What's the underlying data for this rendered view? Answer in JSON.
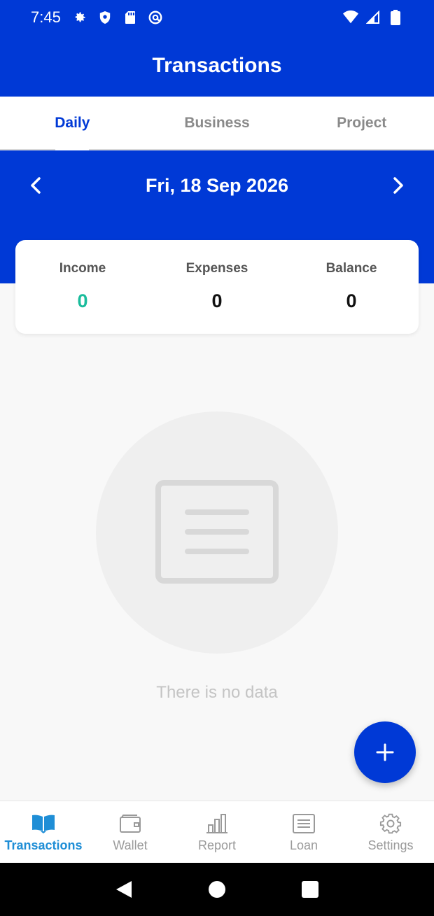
{
  "status_bar": {
    "time": "7:45",
    "left_icons": [
      "gear-icon",
      "shield-icon",
      "sd-card-icon",
      "at-sign-icon"
    ],
    "right_icons": [
      "wifi-icon",
      "signal-icon",
      "battery-icon"
    ]
  },
  "header": {
    "title": "Transactions"
  },
  "tabs": [
    {
      "label": "Daily",
      "active": true
    },
    {
      "label": "Business",
      "active": false
    },
    {
      "label": "Project",
      "active": false
    }
  ],
  "date_nav": {
    "date": "Fri, 18 Sep 2026"
  },
  "summary": {
    "income_label": "Income",
    "income_value": "0",
    "expenses_label": "Expenses",
    "expenses_value": "0",
    "balance_label": "Balance",
    "balance_value": "0"
  },
  "empty_state": {
    "text": "There is no data",
    "icon": "document-icon"
  },
  "fab": {
    "icon": "plus-icon"
  },
  "bottom_nav": [
    {
      "label": "Transactions",
      "icon": "book-icon",
      "active": true
    },
    {
      "label": "Wallet",
      "icon": "wallet-icon",
      "active": false
    },
    {
      "label": "Report",
      "icon": "bar-chart-icon",
      "active": false
    },
    {
      "label": "Loan",
      "icon": "list-icon",
      "active": false
    },
    {
      "label": "Settings",
      "icon": "gear-icon",
      "active": false
    }
  ],
  "colors": {
    "primary": "#0039d6",
    "income": "#1abc9c",
    "nav_active": "#1f8ed6",
    "background": "#f8f8f8"
  }
}
